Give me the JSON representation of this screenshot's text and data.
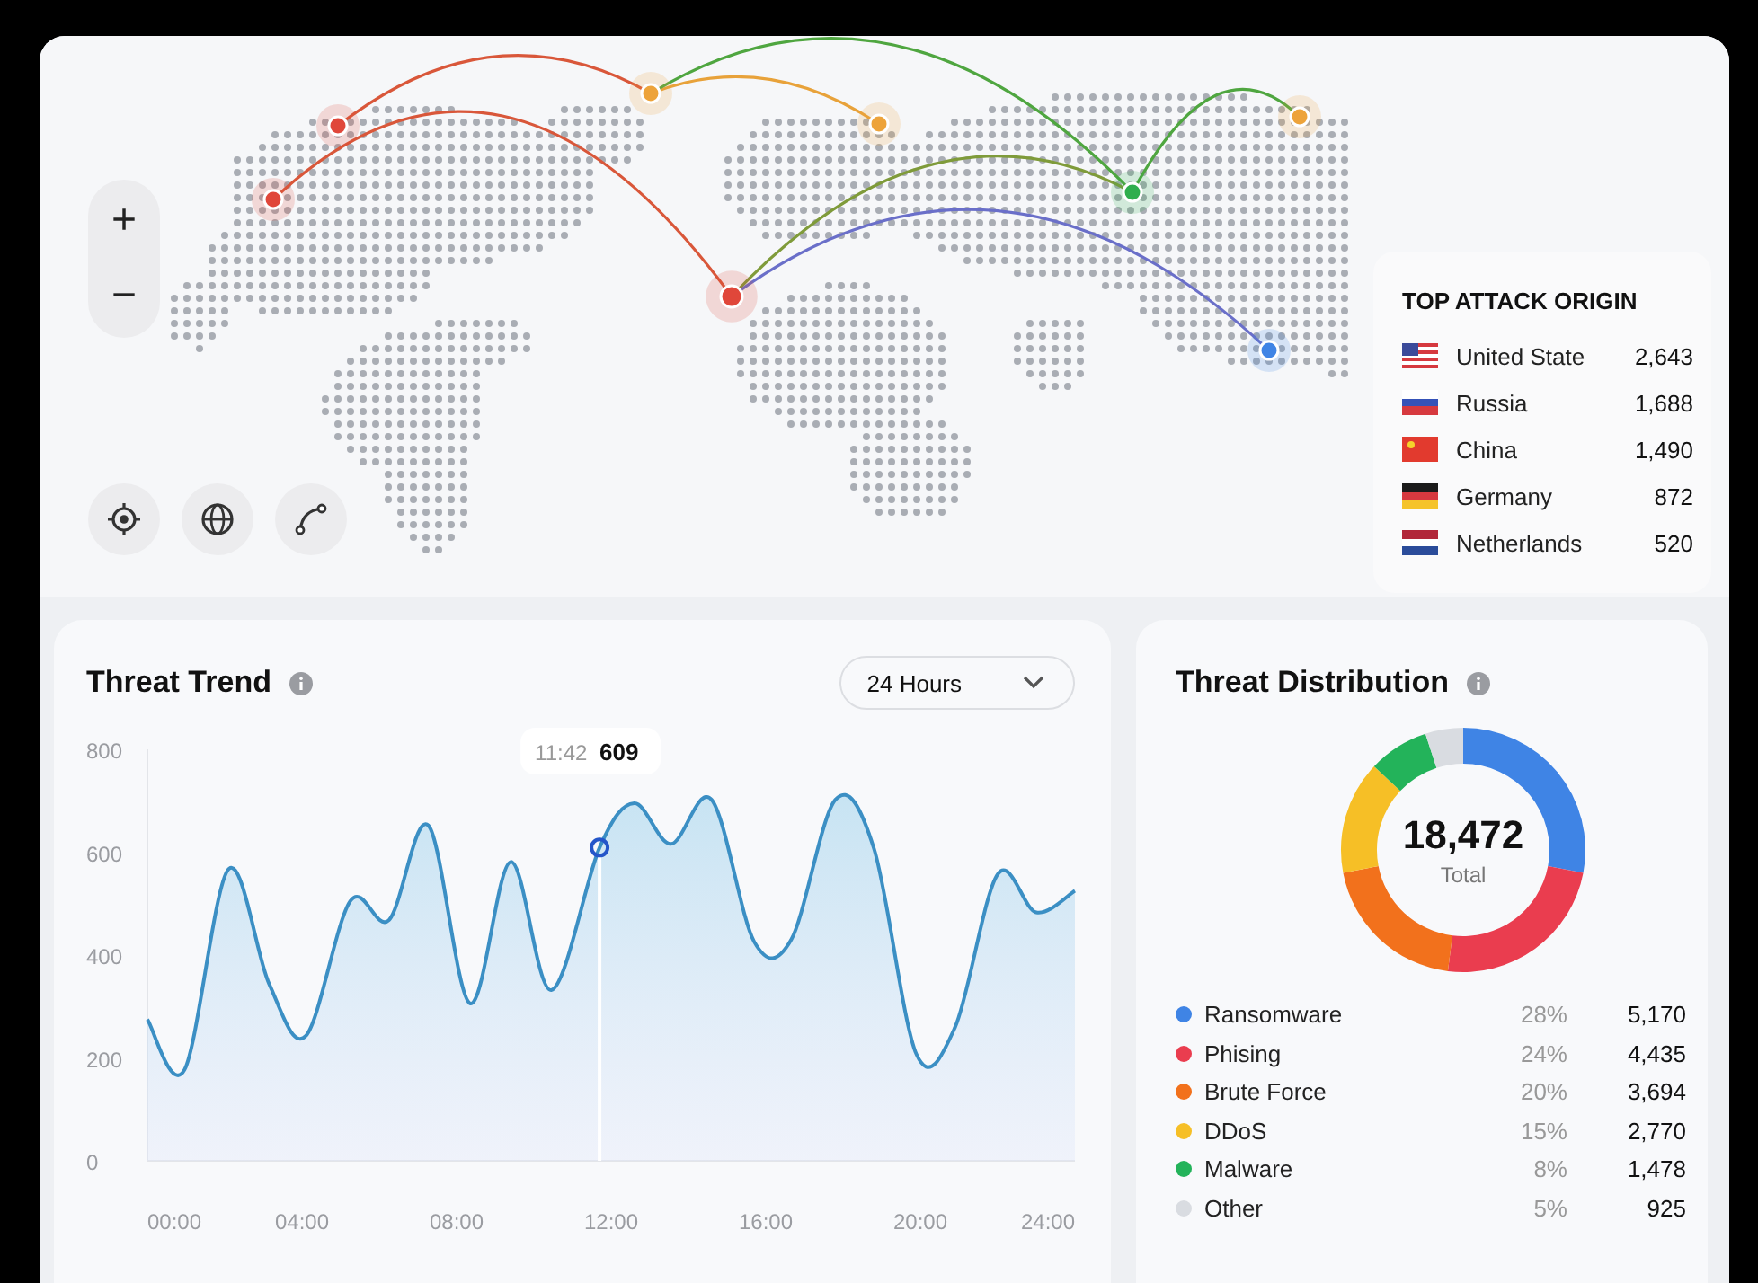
{
  "map": {
    "zoom_in": "+",
    "zoom_out": "−"
  },
  "top_attack_origin": {
    "title": "TOP ATTACK ORIGIN",
    "rows": [
      {
        "kind": "us",
        "country": "United State",
        "count": "2,643"
      },
      {
        "kind": "ru",
        "country": "Russia",
        "count": "1,688"
      },
      {
        "kind": "cn",
        "country": "China",
        "count": "1,490"
      },
      {
        "kind": "de",
        "country": "Germany",
        "count": "872"
      },
      {
        "kind": "nl",
        "country": "Netherlands",
        "count": "520"
      }
    ]
  },
  "threat_trend": {
    "title": "Threat Trend",
    "range": "24 Hours",
    "tooltip": {
      "time": "11:42",
      "value": "609"
    },
    "chart_data": {
      "type": "area",
      "x": [
        0,
        0.96,
        2.1,
        3.15,
        4.1,
        5.25,
        6.25,
        7.27,
        8.35,
        9.4,
        10.45,
        11.7,
        12.6,
        13.55,
        14.6,
        15.7,
        16.66,
        17.8,
        18.8,
        19.9,
        20.9,
        22,
        23,
        24
      ],
      "series": [
        {
          "color": "#3b8fc4",
          "values": [
            275,
            177,
            567,
            344,
            243,
            505,
            468,
            652,
            306,
            581,
            332,
            609,
            695,
            616,
            702,
            426,
            430,
            702,
            607,
            207,
            260,
            557,
            483,
            525
          ]
        }
      ],
      "xlim": [
        0,
        24
      ],
      "ylim": [
        0,
        800
      ],
      "xticks": [
        {
          "value": 0,
          "label": "00:00"
        },
        {
          "value": 4,
          "label": "04:00"
        },
        {
          "value": 8,
          "label": "08:00"
        },
        {
          "value": 12,
          "label": "12:00"
        },
        {
          "value": 16,
          "label": "16:00"
        },
        {
          "value": 20,
          "label": "20:00"
        },
        {
          "value": 24,
          "label": "24:00"
        }
      ],
      "yticks": [
        0,
        200,
        400,
        600,
        800
      ]
    }
  },
  "threat_distribution": {
    "title": "Threat Distribution",
    "total": "18,472",
    "total_label": "Total",
    "chart_data": {
      "type": "donut",
      "categories": [
        "Ransomware",
        "Phising",
        "Brute Force",
        "DDoS",
        "Malware",
        "Other"
      ],
      "values": [
        28,
        24,
        20,
        15,
        8,
        5
      ]
    },
    "legend": [
      {
        "color": "#3f84e5",
        "percent": "28%",
        "count": "5,170"
      },
      {
        "color": "#ea3d4f",
        "percent": "24%",
        "count": "4,435"
      },
      {
        "color": "#f2711c",
        "percent": "20%",
        "count": "3,694"
      },
      {
        "color": "#f6bf26",
        "percent": "15%",
        "count": "2,770"
      },
      {
        "color": "#23b35a",
        "percent": "8%",
        "count": "1,478"
      },
      {
        "color": "#d9dce1",
        "percent": "5%",
        "count": "925"
      }
    ]
  }
}
